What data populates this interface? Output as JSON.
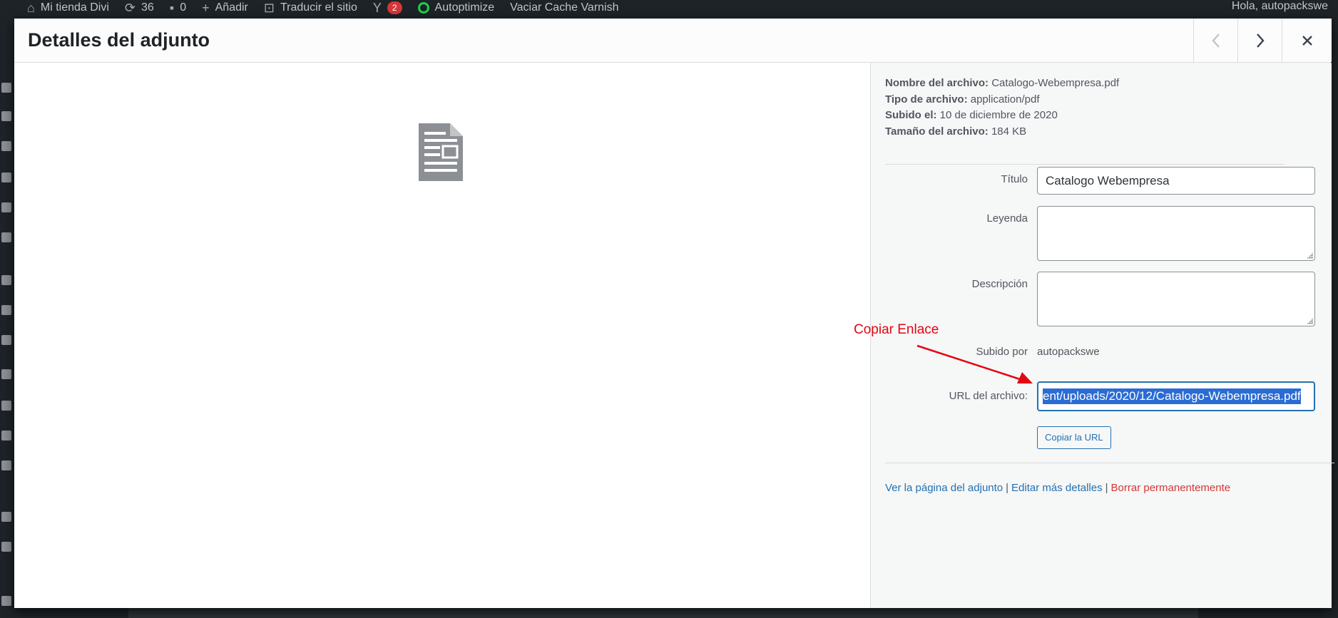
{
  "admin_bar": {
    "site_name": "Mi tienda Divi",
    "updates_count": "36",
    "comments_count": "0",
    "add_new": "Añadir",
    "translate": "Traducir el sitio",
    "seo_badge": "2",
    "autoptimize": "Autoptimize",
    "varnish": "Vaciar Cache Varnish",
    "greeting": "Hola, autopackswe"
  },
  "modal": {
    "title": "Detalles del adjunto",
    "prev_label": "‹",
    "next_label": "›",
    "close_label": "×"
  },
  "file_info": {
    "filename_label": "Nombre del archivo:",
    "filename": "Catalogo-Webempresa.pdf",
    "type_label": "Tipo de archivo:",
    "type": "application/pdf",
    "uploaded_label": "Subido el:",
    "uploaded": "10 de diciembre de 2020",
    "size_label": "Tamaño del archivo:",
    "size": "184 KB"
  },
  "fields": {
    "title_label": "Título",
    "title_value": "Catalogo Webempresa",
    "caption_label": "Leyenda",
    "caption_value": "",
    "description_label": "Descripción",
    "description_value": "",
    "uploaded_by_label": "Subido por",
    "uploaded_by_value": "autopackswe",
    "url_label": "URL del archivo:",
    "url_value": "ent/uploads/2020/12/Catalogo-Webempresa.pdf",
    "copy_button": "Copiar la URL"
  },
  "actions": {
    "view_page": "Ver la página del adjunto",
    "edit_more": "Editar más detalles",
    "delete": "Borrar permanentemente",
    "separator": "|"
  },
  "annotation": {
    "text": "Copiar Enlace",
    "color": "#e30613"
  },
  "colors": {
    "accent": "#2271b1",
    "danger": "#d63638",
    "admin_bar": "#1d2327"
  }
}
